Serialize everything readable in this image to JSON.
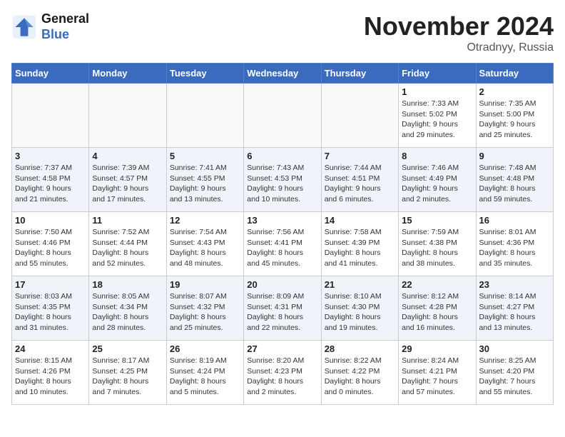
{
  "header": {
    "logo_line1": "General",
    "logo_line2": "Blue",
    "month": "November 2024",
    "location": "Otradnyy, Russia"
  },
  "weekdays": [
    "Sunday",
    "Monday",
    "Tuesday",
    "Wednesday",
    "Thursday",
    "Friday",
    "Saturday"
  ],
  "weeks": [
    [
      {
        "day": "",
        "info": ""
      },
      {
        "day": "",
        "info": ""
      },
      {
        "day": "",
        "info": ""
      },
      {
        "day": "",
        "info": ""
      },
      {
        "day": "",
        "info": ""
      },
      {
        "day": "1",
        "info": "Sunrise: 7:33 AM\nSunset: 5:02 PM\nDaylight: 9 hours\nand 29 minutes."
      },
      {
        "day": "2",
        "info": "Sunrise: 7:35 AM\nSunset: 5:00 PM\nDaylight: 9 hours\nand 25 minutes."
      }
    ],
    [
      {
        "day": "3",
        "info": "Sunrise: 7:37 AM\nSunset: 4:58 PM\nDaylight: 9 hours\nand 21 minutes."
      },
      {
        "day": "4",
        "info": "Sunrise: 7:39 AM\nSunset: 4:57 PM\nDaylight: 9 hours\nand 17 minutes."
      },
      {
        "day": "5",
        "info": "Sunrise: 7:41 AM\nSunset: 4:55 PM\nDaylight: 9 hours\nand 13 minutes."
      },
      {
        "day": "6",
        "info": "Sunrise: 7:43 AM\nSunset: 4:53 PM\nDaylight: 9 hours\nand 10 minutes."
      },
      {
        "day": "7",
        "info": "Sunrise: 7:44 AM\nSunset: 4:51 PM\nDaylight: 9 hours\nand 6 minutes."
      },
      {
        "day": "8",
        "info": "Sunrise: 7:46 AM\nSunset: 4:49 PM\nDaylight: 9 hours\nand 2 minutes."
      },
      {
        "day": "9",
        "info": "Sunrise: 7:48 AM\nSunset: 4:48 PM\nDaylight: 8 hours\nand 59 minutes."
      }
    ],
    [
      {
        "day": "10",
        "info": "Sunrise: 7:50 AM\nSunset: 4:46 PM\nDaylight: 8 hours\nand 55 minutes."
      },
      {
        "day": "11",
        "info": "Sunrise: 7:52 AM\nSunset: 4:44 PM\nDaylight: 8 hours\nand 52 minutes."
      },
      {
        "day": "12",
        "info": "Sunrise: 7:54 AM\nSunset: 4:43 PM\nDaylight: 8 hours\nand 48 minutes."
      },
      {
        "day": "13",
        "info": "Sunrise: 7:56 AM\nSunset: 4:41 PM\nDaylight: 8 hours\nand 45 minutes."
      },
      {
        "day": "14",
        "info": "Sunrise: 7:58 AM\nSunset: 4:39 PM\nDaylight: 8 hours\nand 41 minutes."
      },
      {
        "day": "15",
        "info": "Sunrise: 7:59 AM\nSunset: 4:38 PM\nDaylight: 8 hours\nand 38 minutes."
      },
      {
        "day": "16",
        "info": "Sunrise: 8:01 AM\nSunset: 4:36 PM\nDaylight: 8 hours\nand 35 minutes."
      }
    ],
    [
      {
        "day": "17",
        "info": "Sunrise: 8:03 AM\nSunset: 4:35 PM\nDaylight: 8 hours\nand 31 minutes."
      },
      {
        "day": "18",
        "info": "Sunrise: 8:05 AM\nSunset: 4:34 PM\nDaylight: 8 hours\nand 28 minutes."
      },
      {
        "day": "19",
        "info": "Sunrise: 8:07 AM\nSunset: 4:32 PM\nDaylight: 8 hours\nand 25 minutes."
      },
      {
        "day": "20",
        "info": "Sunrise: 8:09 AM\nSunset: 4:31 PM\nDaylight: 8 hours\nand 22 minutes."
      },
      {
        "day": "21",
        "info": "Sunrise: 8:10 AM\nSunset: 4:30 PM\nDaylight: 8 hours\nand 19 minutes."
      },
      {
        "day": "22",
        "info": "Sunrise: 8:12 AM\nSunset: 4:28 PM\nDaylight: 8 hours\nand 16 minutes."
      },
      {
        "day": "23",
        "info": "Sunrise: 8:14 AM\nSunset: 4:27 PM\nDaylight: 8 hours\nand 13 minutes."
      }
    ],
    [
      {
        "day": "24",
        "info": "Sunrise: 8:15 AM\nSunset: 4:26 PM\nDaylight: 8 hours\nand 10 minutes."
      },
      {
        "day": "25",
        "info": "Sunrise: 8:17 AM\nSunset: 4:25 PM\nDaylight: 8 hours\nand 7 minutes."
      },
      {
        "day": "26",
        "info": "Sunrise: 8:19 AM\nSunset: 4:24 PM\nDaylight: 8 hours\nand 5 minutes."
      },
      {
        "day": "27",
        "info": "Sunrise: 8:20 AM\nSunset: 4:23 PM\nDaylight: 8 hours\nand 2 minutes."
      },
      {
        "day": "28",
        "info": "Sunrise: 8:22 AM\nSunset: 4:22 PM\nDaylight: 8 hours\nand 0 minutes."
      },
      {
        "day": "29",
        "info": "Sunrise: 8:24 AM\nSunset: 4:21 PM\nDaylight: 7 hours\nand 57 minutes."
      },
      {
        "day": "30",
        "info": "Sunrise: 8:25 AM\nSunset: 4:20 PM\nDaylight: 7 hours\nand 55 minutes."
      }
    ]
  ]
}
